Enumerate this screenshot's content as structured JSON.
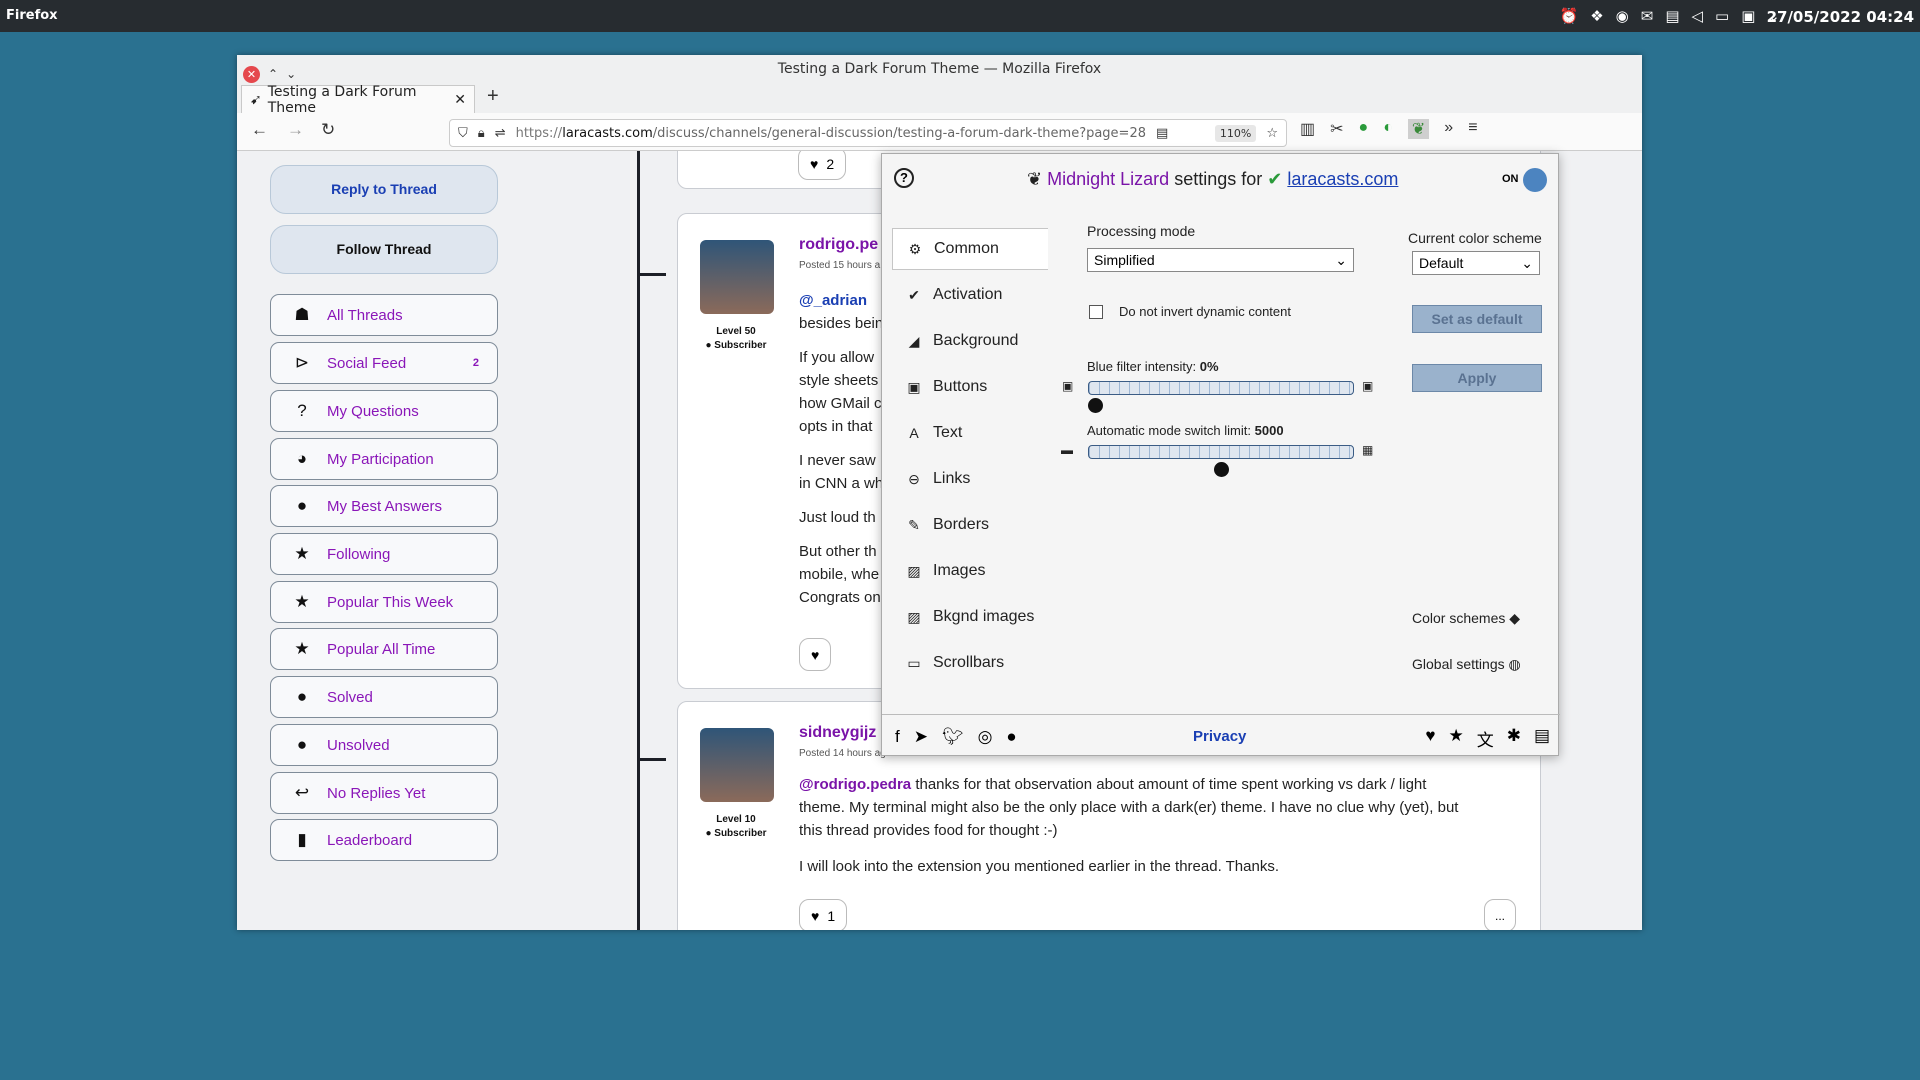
{
  "system": {
    "app": "Firefox",
    "clock": "27/05/2022 04:24",
    "tray_icons": [
      "alarm-icon",
      "dropbox-icon",
      "accessibility-icon",
      "mail-icon",
      "clipboard-icon",
      "mute-icon",
      "display-icon",
      "monitor-icon",
      "chevron-down-icon"
    ]
  },
  "window": {
    "title": "Testing a Dark Forum Theme — Mozilla Firefox",
    "tab_label": "Testing a Dark Forum Theme",
    "url_prefix": "https://",
    "url_host": "laracasts.com",
    "url_path": "/discuss/channels/general-discussion/testing-a-forum-dark-theme?page=28",
    "zoom": "110%"
  },
  "sidebar": {
    "reply": "Reply to Thread",
    "follow": "Follow Thread",
    "items": [
      {
        "label": "All Threads",
        "icon": "☗"
      },
      {
        "label": "Social Feed",
        "icon": "⊳",
        "badge": "2"
      },
      {
        "label": "My Questions",
        "icon": "?"
      },
      {
        "label": "My Participation",
        "icon": "◕"
      },
      {
        "label": "My Best Answers",
        "icon": "●"
      },
      {
        "label": "Following",
        "icon": "★"
      },
      {
        "label": "Popular This Week",
        "icon": "★"
      },
      {
        "label": "Popular All Time",
        "icon": "★"
      },
      {
        "label": "Solved",
        "icon": "●"
      },
      {
        "label": "Unsolved",
        "icon": "●"
      },
      {
        "label": "No Replies Yet",
        "icon": "↩"
      },
      {
        "label": "Leaderboard",
        "icon": "▮"
      }
    ]
  },
  "posts": {
    "top_likes": "2",
    "p1": {
      "user": "rodrigo.pe",
      "posted": "Posted 15 hours a",
      "level": "Level 50",
      "role": "Subscriber",
      "mention": "@_adrian",
      "lines": [
        "besides bein",
        "If you allow",
        "style sheets",
        "how GMail c",
        "opts in that",
        "I never saw",
        "in CNN a wh",
        "Just loud th",
        "But other th",
        "mobile, whe",
        "Congrats on"
      ]
    },
    "p2": {
      "user": "sidneygijz",
      "posted": "Posted 14 hours ago",
      "level": "Level 10",
      "role": "Subscriber",
      "mention": "@rodrigo.pedra",
      "line1": "thanks for that observation about amount of time spent working vs dark / light",
      "line2": "theme. My terminal might also be the only place with a dark(er) theme. I have no clue why (yet), but",
      "line3": "this thread provides food for thought :-)",
      "line4": "I will look into the extension you mentioned earlier in the thread. Thanks.",
      "likes": "1",
      "more": "..."
    }
  },
  "popup": {
    "brand": "Midnight Lizard",
    "settings_for": "settings for",
    "domain": "laracasts.com",
    "on_label": "ON",
    "menu": [
      {
        "label": "Common",
        "icon": "⚙"
      },
      {
        "label": "Activation",
        "icon": "✔"
      },
      {
        "label": "Background",
        "icon": "◢"
      },
      {
        "label": "Buttons",
        "icon": "▣"
      },
      {
        "label": "Text",
        "icon": "A"
      },
      {
        "label": "Links",
        "icon": "⊖"
      },
      {
        "label": "Borders",
        "icon": "✎"
      },
      {
        "label": "Images",
        "icon": "▨"
      },
      {
        "label": "Bkgnd images",
        "icon": "▨"
      },
      {
        "label": "Scrollbars",
        "icon": "▭"
      }
    ],
    "processing_mode_label": "Processing mode",
    "processing_mode_value": "Simplified",
    "no_invert_label": "Do not invert dynamic content",
    "blue_filter_label": "Blue filter intensity:",
    "blue_filter_value": "0%",
    "blue_filter_level": 0,
    "auto_switch_label": "Automatic mode switch limit:",
    "auto_switch_value": "5000",
    "auto_switch_level": 0.5,
    "color_scheme_label": "Current color scheme",
    "color_scheme_value": "Default",
    "set_default": "Set as default",
    "apply": "Apply",
    "color_schemes_link": "Color schemes",
    "global_settings_link": "Global settings",
    "privacy": "Privacy"
  }
}
